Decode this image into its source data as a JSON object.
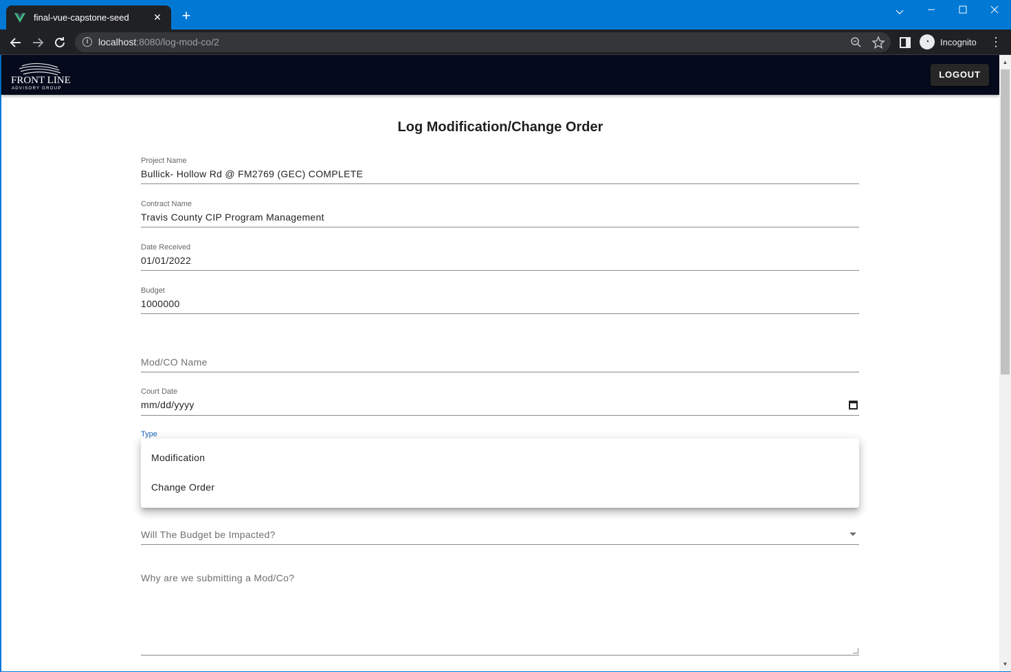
{
  "browser": {
    "tab_title": "final-vue-capstone-seed",
    "tab_close": "✕",
    "new_tab": "+",
    "url_host": "localhost",
    "url_path": ":8080/log-mod-co/2",
    "profile_label": "Incognito",
    "accent_color": "#0078d4"
  },
  "app": {
    "logo_text_line1": "FRONT LINE",
    "logo_text_line2": "ADVISORY GROUP",
    "logout_label": "LOGOUT"
  },
  "form": {
    "title": "Log Modification/Change Order",
    "project_name": {
      "label": "Project Name",
      "value": "Bullick- Hollow Rd @ FM2769 (GEC) COMPLETE"
    },
    "contract_name": {
      "label": "Contract Name",
      "value": "Travis County CIP Program Management"
    },
    "date_received": {
      "label": "Date Received",
      "value": "01/01/2022"
    },
    "budget": {
      "label": "Budget",
      "value": "1000000"
    },
    "mod_co_name": {
      "placeholder": "Mod/CO Name"
    },
    "court_date": {
      "label": "Court Date",
      "value": "mm/dd/yyyy"
    },
    "type": {
      "label": "Type",
      "options": [
        "Modification",
        "Change Order"
      ]
    },
    "budget_impacted": {
      "placeholder": "Will The Budget be Impacted?"
    },
    "reason": {
      "placeholder": "Why are we submitting a Mod/Co?"
    }
  }
}
